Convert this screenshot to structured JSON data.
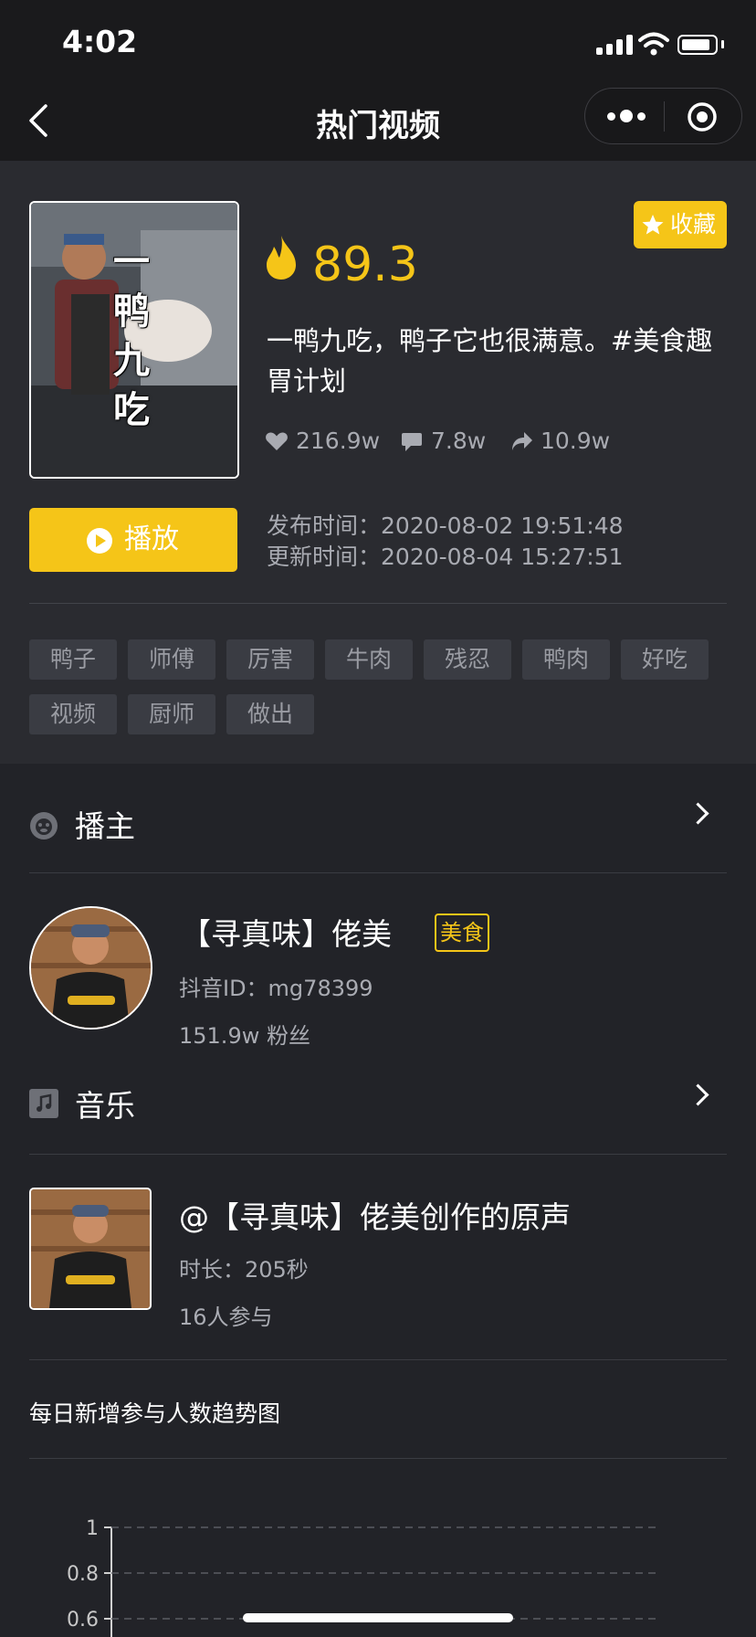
{
  "status_bar": {
    "time": "4:02"
  },
  "nav": {
    "title": "热门视频"
  },
  "video": {
    "thumb_text": [
      "一",
      "鸭",
      "九",
      "吃"
    ],
    "fav_label": "收藏",
    "heat": "89.3",
    "title": "一鸭九吃，鸭子它也很满意。#美食趣胃计划",
    "likes": "216.9w",
    "comments": "7.8w",
    "shares": "10.9w",
    "play_label": "播放",
    "publish_label": "发布时间：",
    "publish_time": "2020-08-02 19:51:48",
    "update_label": "更新时间：",
    "update_time": "2020-08-04 15:27:51",
    "tags": [
      "鸭子",
      "师傅",
      "厉害",
      "牛肉",
      "残忍",
      "鸭肉",
      "好吃",
      "视频",
      "厨师",
      "做出"
    ]
  },
  "anchor": {
    "section_title": "播主",
    "name": "【寻真味】佬美",
    "category": "美食",
    "douyin_id": "抖音ID：mg78399",
    "followers": "151.9w 粉丝"
  },
  "music": {
    "section_title": "音乐",
    "title": "@【寻真味】佬美创作的原声",
    "duration": "时长：205秒",
    "participants": "16人参与"
  },
  "trend": {
    "title": "每日新增参与人数趋势图"
  },
  "chart_data": {
    "type": "line",
    "title": "",
    "xlabel": "",
    "ylabel": "",
    "ylim": [
      0,
      1
    ],
    "y_ticks": [
      "1",
      "0.8",
      "0.6"
    ],
    "grid": true,
    "series": []
  },
  "colors": {
    "accent": "#f5c518",
    "background": "#222328",
    "card": "#2a2b30"
  }
}
